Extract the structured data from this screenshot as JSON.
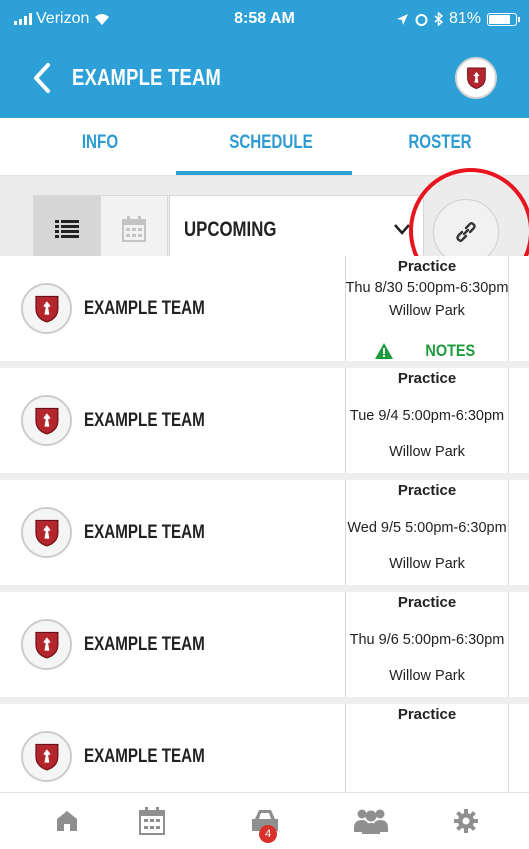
{
  "status_bar": {
    "carrier": "Verizon",
    "time": "8:58 AM",
    "battery": "81%"
  },
  "header": {
    "title": "EXAMPLE TEAM"
  },
  "tabs": [
    {
      "label": "INFO"
    },
    {
      "label": "SCHEDULE"
    },
    {
      "label": "ROSTER"
    }
  ],
  "active_tab": "SCHEDULE",
  "filter": {
    "selected": "UPCOMING"
  },
  "events": [
    {
      "team": "EXAMPLE TEAM",
      "type": "Practice",
      "datetime": "Thu 8/30 5:00pm-6:30pm",
      "location": "Willow Park",
      "notes": "NOTES"
    },
    {
      "team": "EXAMPLE TEAM",
      "type": "Practice",
      "datetime": "Tue 9/4 5:00pm-6:30pm",
      "location": "Willow Park"
    },
    {
      "team": "EXAMPLE TEAM",
      "type": "Practice",
      "datetime": "Wed 9/5 5:00pm-6:30pm",
      "location": "Willow Park"
    },
    {
      "team": "EXAMPLE TEAM",
      "type": "Practice",
      "datetime": "Thu 9/6 5:00pm-6:30pm",
      "location": "Willow Park"
    },
    {
      "team": "EXAMPLE TEAM",
      "type": "Practice",
      "datetime": "",
      "location": ""
    }
  ],
  "bottom_nav": {
    "badge_count": "4"
  },
  "icons": [
    "home-icon",
    "calendar-icon",
    "car-icon",
    "team-icon",
    "settings-icon",
    "link-icon",
    "list-view-icon",
    "calendar-view-icon",
    "warning-icon"
  ],
  "colors": {
    "brand": "#2da0d7",
    "notes": "#1e9b3b",
    "highlight": "#e8141e",
    "badge": "#d9302c"
  }
}
